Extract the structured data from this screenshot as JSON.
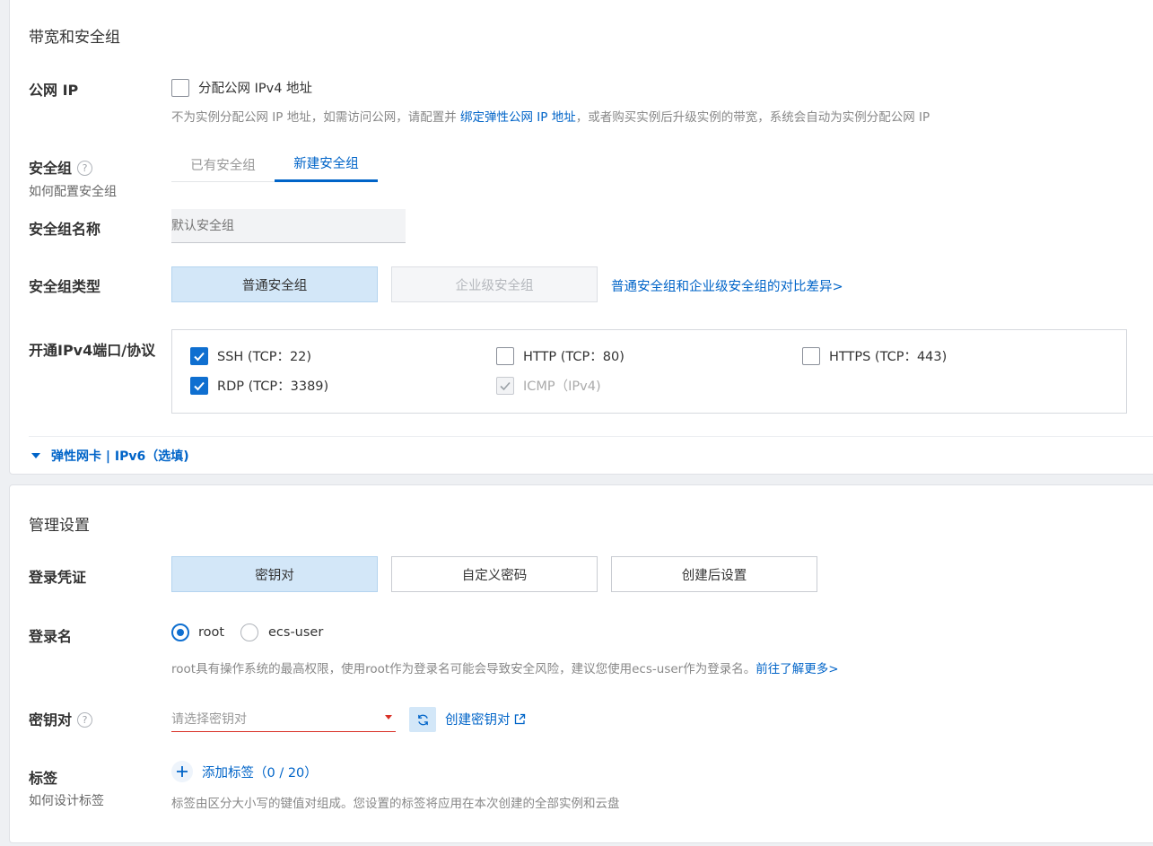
{
  "network": {
    "section_title": "带宽和安全组",
    "public_ip": {
      "label": "公网 IP",
      "checkbox_label": "分配公网 IPv4 地址",
      "hint_prefix": "不为实例分配公网 IP 地址，如需访问公网，请配置并",
      "hint_link": "绑定弹性公网 IP 地址",
      "hint_suffix": "，或者购买实例后升级实例的带宽，系统会自动为实例分配公网 IP"
    },
    "security_group": {
      "label": "安全组",
      "help_icon": "question-circle-icon",
      "sub_link": "如何配置安全组",
      "tabs": [
        "已有安全组",
        "新建安全组"
      ],
      "active_tab": "新建安全组"
    },
    "sg_name": {
      "label": "安全组名称",
      "placeholder": "默认安全组"
    },
    "sg_type": {
      "label": "安全组类型",
      "options": [
        "普通安全组",
        "企业级安全组"
      ],
      "selected": "普通安全组",
      "compare_link": "普通安全组和企业级安全组的对比差异"
    },
    "ports": {
      "label": "开通IPv4端口/协议",
      "items": [
        {
          "label": "SSH (TCP：22)",
          "checked": true,
          "disabled": false
        },
        {
          "label": "HTTP (TCP：80)",
          "checked": false,
          "disabled": false
        },
        {
          "label": "HTTPS (TCP：443)",
          "checked": false,
          "disabled": false
        },
        {
          "label": "RDP (TCP：3389)",
          "checked": true,
          "disabled": false
        },
        {
          "label": "ICMP（IPv4)",
          "checked": true,
          "disabled": true
        }
      ]
    },
    "expand": {
      "icon": "caret-down-icon",
      "label": "弹性网卡 | IPv6（选填)"
    }
  },
  "management": {
    "section_title": "管理设置",
    "credential": {
      "label": "登录凭证",
      "options": [
        "密钥对",
        "自定义密码",
        "创建后设置"
      ],
      "selected": "密钥对"
    },
    "login_name": {
      "label": "登录名",
      "options": [
        "root",
        "ecs-user"
      ],
      "selected": "root",
      "hint": "root具有操作系统的最高权限，使用root作为登录名可能会导致安全风险，建议您使用ecs-user作为登录名。",
      "hint_link": "前往了解更多"
    },
    "keypair": {
      "label": "密钥对",
      "help_icon": "question-circle-icon",
      "placeholder": "请选择密钥对",
      "refresh_icon": "refresh-icon",
      "create_link": "创建密钥对",
      "external_icon": "external-link-icon"
    },
    "tags": {
      "label": "标签",
      "sub_link": "如何设计标签",
      "add_icon": "plus-icon",
      "add_label": "添加标签",
      "count": "（0 / 20）",
      "hint": "标签由区分大小写的键值对组成。您设置的标签将应用在本次创建的全部实例和云盘"
    }
  },
  "colors": {
    "accent": "#0064c8",
    "selected_bg": "#d3e7f8",
    "error_underline": "#d93026"
  }
}
